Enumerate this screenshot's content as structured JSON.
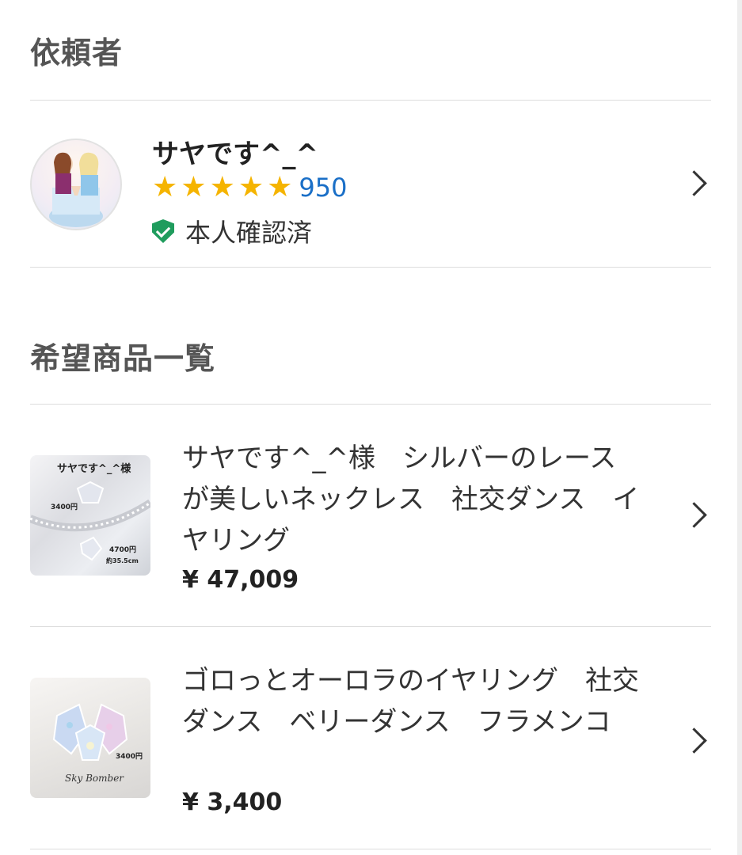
{
  "requester_section": {
    "title": "依頼者",
    "name": "サヤです^_^",
    "rating": {
      "stars": 5,
      "count": "950"
    },
    "verified_label": "本人確認済"
  },
  "wishlist_section": {
    "title": "希望商品一覧",
    "items": [
      {
        "title": "サヤです^_^様　シルバーのレースが美しいネックレス　社交ダンス　イヤリング",
        "price": "¥ 47,009",
        "thumb_caption": "サヤです^_^様",
        "thumb_price_1": "3400円",
        "thumb_price_2": "4700円",
        "thumb_size": "約35.5cm"
      },
      {
        "title": "ゴロっとオーロラのイヤリング　社交ダンス　ベリーダンス　フラメンコ",
        "price": "¥ 3,400",
        "thumb_price": "3400円",
        "thumb_brand": "Sky Bomber"
      }
    ]
  },
  "colors": {
    "star": "#f5b400",
    "rating_link": "#1a6fc7",
    "verified_shield": "#1f9c5d",
    "divider": "#dddddd"
  }
}
